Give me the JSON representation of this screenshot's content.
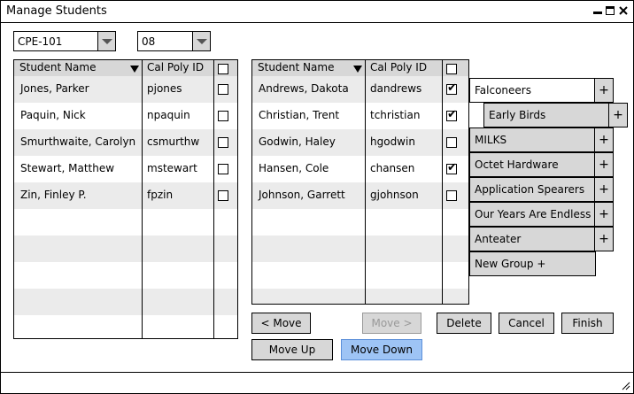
{
  "window": {
    "title": "Manage Students"
  },
  "filters": {
    "course": "CPE-101",
    "section": "08"
  },
  "left_grid": {
    "headers": {
      "name": "Student Name",
      "id": "Cal Poly ID"
    },
    "rows": [
      {
        "name": "Jones, Parker",
        "id": "pjones",
        "checked": false
      },
      {
        "name": "Paquin, Nick",
        "id": "npaquin",
        "checked": false
      },
      {
        "name": "Smurthwaite, Carolyn",
        "id": "csmurthw",
        "checked": false
      },
      {
        "name": "Stewart, Matthew",
        "id": "mstewart",
        "checked": false
      },
      {
        "name": "Zin, Finley P.",
        "id": "fpzin",
        "checked": false
      }
    ]
  },
  "right_grid": {
    "headers": {
      "name": "Student Name",
      "id": "Cal Poly ID"
    },
    "rows": [
      {
        "name": "Andrews, Dakota",
        "id": "dandrews",
        "checked": true
      },
      {
        "name": "Christian, Trent",
        "id": "tchristian",
        "checked": true
      },
      {
        "name": "Godwin, Haley",
        "id": "hgodwin",
        "checked": false
      },
      {
        "name": "Hansen, Cole",
        "id": "chansen",
        "checked": true
      },
      {
        "name": "Johnson, Garrett",
        "id": "gjohnson",
        "checked": false
      }
    ]
  },
  "groups": [
    {
      "label": "Falconeers",
      "active": true,
      "indent": false
    },
    {
      "label": "Early Birds",
      "active": false,
      "indent": true
    },
    {
      "label": "MILKS",
      "active": false,
      "indent": false
    },
    {
      "label": "Octet Hardware",
      "active": false,
      "indent": false
    },
    {
      "label": "Application Spearers",
      "active": false,
      "indent": false
    },
    {
      "label": "Our Years Are Endless",
      "active": false,
      "indent": false
    },
    {
      "label": "Anteater",
      "active": false,
      "indent": false
    }
  ],
  "new_group_label": "New Group +",
  "buttons": {
    "move_left": "< Move",
    "move_right": "Move >",
    "delete": "Delete",
    "cancel": "Cancel",
    "finish": "Finish",
    "move_up": "Move Up",
    "move_down": "Move Down"
  }
}
